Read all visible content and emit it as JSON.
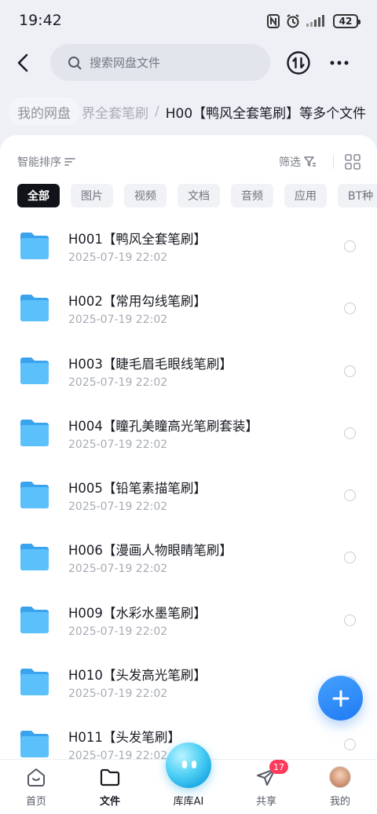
{
  "status": {
    "time": "19:42",
    "battery": "42"
  },
  "search": {
    "placeholder": "搜索网盘文件"
  },
  "breadcrumb": {
    "root": "我的网盘",
    "faded": "界全套笔刷",
    "separator": "/",
    "current": "H00【鸭风全套笔刷】等多个文件"
  },
  "toolbar": {
    "sort_label": "智能排序",
    "filter_label": "筛选"
  },
  "tabs": [
    "全部",
    "图片",
    "视频",
    "文档",
    "音频",
    "应用",
    "BT种"
  ],
  "files": [
    {
      "name": "H001【鸭风全套笔刷】",
      "date": "2025-07-19  22:02"
    },
    {
      "name": "H002【常用勾线笔刷】",
      "date": "2025-07-19  22:02"
    },
    {
      "name": "H003【睫毛眉毛眼线笔刷】",
      "date": "2025-07-19  22:02"
    },
    {
      "name": "H004【瞳孔美瞳高光笔刷套装】",
      "date": "2025-07-19  22:02"
    },
    {
      "name": "H005【铅笔素描笔刷】",
      "date": "2025-07-19  22:02"
    },
    {
      "name": "H006【漫画人物眼睛笔刷】",
      "date": "2025-07-19  22:02"
    },
    {
      "name": "H009【水彩水墨笔刷】",
      "date": "2025-07-19  22:02"
    },
    {
      "name": "H010【头发高光笔刷】",
      "date": "2025-07-19  22:02"
    },
    {
      "name": "H011【头发笔刷】",
      "date": "2025-07-19  22:02"
    }
  ],
  "nav": {
    "home": "首页",
    "files": "文件",
    "ai": "库库AI",
    "share": "共享",
    "share_badge": "17",
    "mine": "我的"
  },
  "colors": {
    "accent": "#1f7cf2",
    "folder": "#4fb3f6",
    "badge": "#ff3b5c"
  }
}
